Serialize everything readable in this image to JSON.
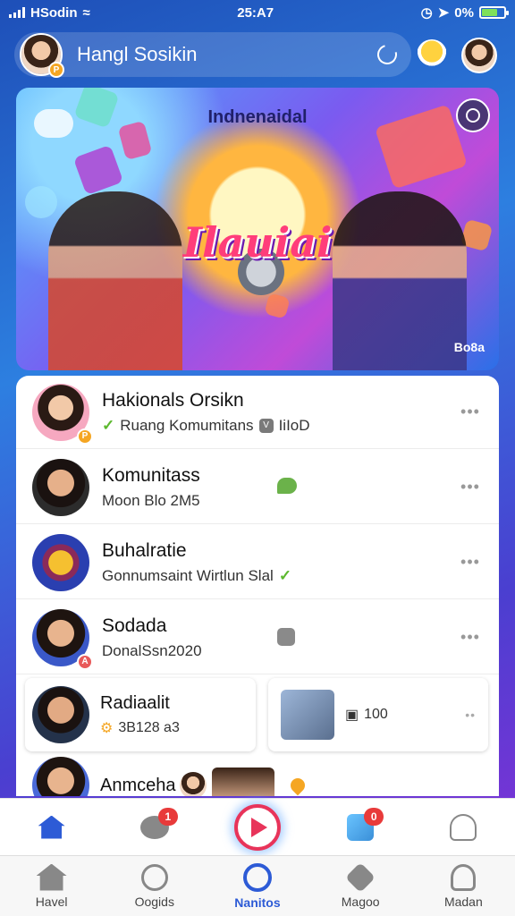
{
  "status_bar": {
    "carrier": "HSodin",
    "time": "25:A7",
    "battery": "0%"
  },
  "header": {
    "title": "Hangl Sosikin"
  },
  "hero": {
    "subtitle": "Indnenaidal",
    "title": "Ilauiai",
    "corner_text": "Bo8a"
  },
  "list": [
    {
      "title": "Hakionals Orsikn",
      "sub": "Ruang Komumitans",
      "sub_tail": "IiIoD",
      "badge": "P"
    },
    {
      "title": "Komunitass",
      "sub": "Moon Blo 2M5"
    },
    {
      "title": "Buhalratie",
      "sub": "Gonnumsaint Wirtlun Slal"
    },
    {
      "title": "Sodada",
      "sub": "DonalSsn2020",
      "badge": "A"
    }
  ],
  "cards": {
    "left": {
      "title": "Radiaalit",
      "sub": "3B128 a3"
    },
    "right": {
      "sub": "100"
    }
  },
  "last_item": {
    "title": "Anmceha"
  },
  "actions": {
    "chat_count": "1",
    "music_count": "0"
  },
  "tabs": [
    {
      "label": "Havel"
    },
    {
      "label": "Oogids"
    },
    {
      "label": "Nanitos"
    },
    {
      "label": "Magoo"
    },
    {
      "label": "Madan"
    }
  ],
  "icons": {
    "home": "home-icon",
    "chat": "chat-icon",
    "play": "play-icon",
    "music": "music-icon",
    "user": "user-icon",
    "search": "search-icon",
    "map": "map-icon",
    "refresh": "refresh-icon",
    "bulb": "bulb-icon"
  },
  "colors": {
    "accent": "#2d5bd6",
    "badge_red": "#e83a3a",
    "play_red": "#e8345a",
    "verified_green": "#5cb82e"
  }
}
